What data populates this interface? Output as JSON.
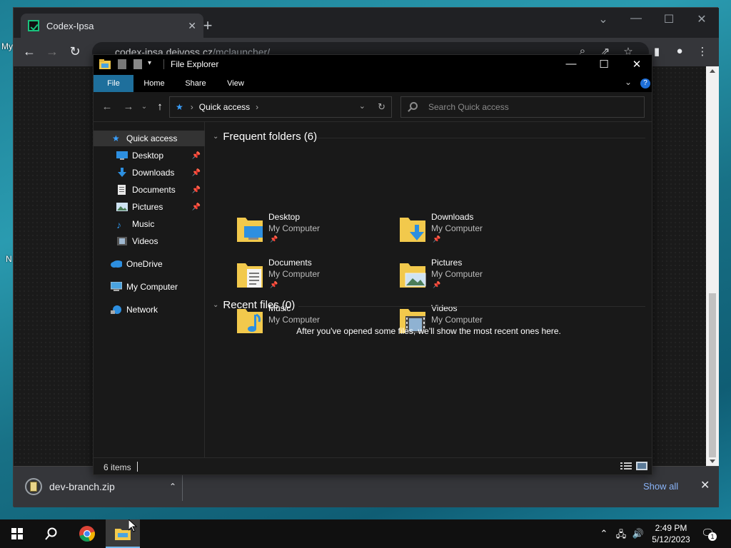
{
  "desktop": {
    "partial_labels": [
      "My",
      "N"
    ]
  },
  "chrome": {
    "tab_title": "Codex-Ipsa",
    "url_host": "codex-ipsa.dejvoss.cz",
    "url_path": "/mclauncher/",
    "download": {
      "filename": "dev-branch.zip",
      "show_all": "Show all"
    }
  },
  "explorer": {
    "title": "File Explorer",
    "ribbon_tabs": [
      "File",
      "Home",
      "Share",
      "View"
    ],
    "help": "?",
    "address": {
      "crumb": "Quick access"
    },
    "search_placeholder": "Search Quick access",
    "nav": {
      "quick_access": "Quick access",
      "items": [
        {
          "label": "Desktop",
          "pinned": true,
          "icon": "desktop-icon"
        },
        {
          "label": "Downloads",
          "pinned": true,
          "icon": "downloads-icon"
        },
        {
          "label": "Documents",
          "pinned": true,
          "icon": "documents-icon"
        },
        {
          "label": "Pictures",
          "pinned": true,
          "icon": "pictures-icon"
        },
        {
          "label": "Music",
          "pinned": false,
          "icon": "music-icon"
        },
        {
          "label": "Videos",
          "pinned": false,
          "icon": "videos-icon"
        }
      ],
      "onedrive": "OneDrive",
      "my_computer": "My Computer",
      "network": "Network"
    },
    "frequent": {
      "header": "Frequent folders (6)",
      "folders": [
        {
          "name": "Desktop",
          "location": "My Computer",
          "pinned": true
        },
        {
          "name": "Downloads",
          "location": "My Computer",
          "pinned": true
        },
        {
          "name": "Documents",
          "location": "My Computer",
          "pinned": true
        },
        {
          "name": "Pictures",
          "location": "My Computer",
          "pinned": true
        },
        {
          "name": "Music",
          "location": "My Computer",
          "pinned": false
        },
        {
          "name": "Videos",
          "location": "My Computer",
          "pinned": false
        }
      ]
    },
    "recent": {
      "header": "Recent files (0)",
      "empty_message": "After you've opened some files, we'll show the most recent ones here."
    },
    "status": {
      "item_count": "6 items"
    }
  },
  "taskbar": {
    "time": "2:49 PM",
    "date": "5/12/2023",
    "notification_count": "1"
  },
  "colors": {
    "accent": "#1e6f9c",
    "link": "#8ab4f8",
    "folder_yellow": "#f2c94c"
  }
}
